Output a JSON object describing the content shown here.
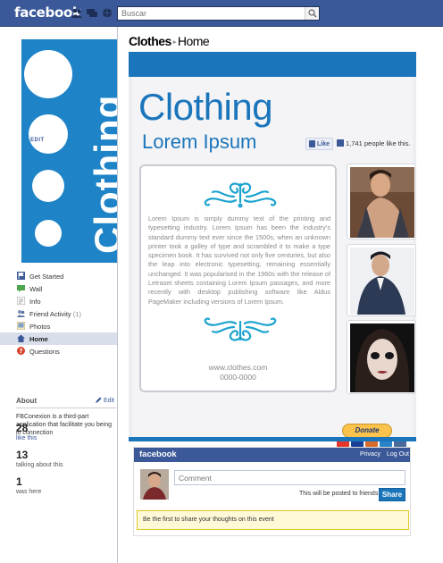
{
  "topbar": {
    "logo": "facebook",
    "search_placeholder": "Buscar"
  },
  "profile": {
    "picture_text": "Clothing"
  },
  "nav": {
    "items": [
      {
        "label": "Get Started",
        "icon": "flag-icon"
      },
      {
        "label": "Wall",
        "icon": "wall-icon"
      },
      {
        "label": "Info",
        "icon": "info-icon"
      },
      {
        "label": "Friend Activity",
        "count": "(1)",
        "icon": "friends-icon"
      },
      {
        "label": "Photos",
        "icon": "photos-icon"
      },
      {
        "label": "Home",
        "icon": "home-icon",
        "active": true
      },
      {
        "label": "Questions",
        "icon": "question-icon"
      }
    ],
    "edit": "EDIT"
  },
  "about": {
    "title": "About",
    "edit": "Edit",
    "text": "FBConexion is a third-part application that facilitate you being in connection"
  },
  "stats": [
    {
      "num": "28",
      "caption": "like this"
    },
    {
      "num": "13",
      "caption": "talking about this"
    },
    {
      "num": "1",
      "caption": "was here"
    }
  ],
  "breadcrumb": {
    "page": "Clothes",
    "separator": "▸",
    "current": "Home"
  },
  "app": {
    "heading": "Clothing",
    "subheading": "Lorem Ipsum",
    "like_button": "Like",
    "like_count": "1,741 people like this.",
    "body": "Lorem Ipsum is simply dummy text of the printing and typesetting industry. Lorem Ipsum has been the industry's standard dummy text ever since the 1500s, when an unknown printer took a galley of type and scrambled it to make a type specimen book. It has survived not only five centuries, but also the leap into electronic typesetting, remaining essentially unchanged. It was popularised in the 1960s with the release of Letraset sheets containing Lorem Ipsum passages, and more recently with desktop publishing software like Aldus PageMaker including versions of Lorem Ipsum.",
    "url": "www.clothes.com",
    "phone": "0000-0000",
    "donate": "Donate",
    "accent_color": "#1b75bb"
  },
  "comments": {
    "brand": "facebook",
    "privacy": "Privacy",
    "logout": "Log Out",
    "input_placeholder": "Comment",
    "post_note": "This will be posted to friends",
    "share": "Share",
    "empty_note": "Be the first to share your thoughts on this event"
  }
}
